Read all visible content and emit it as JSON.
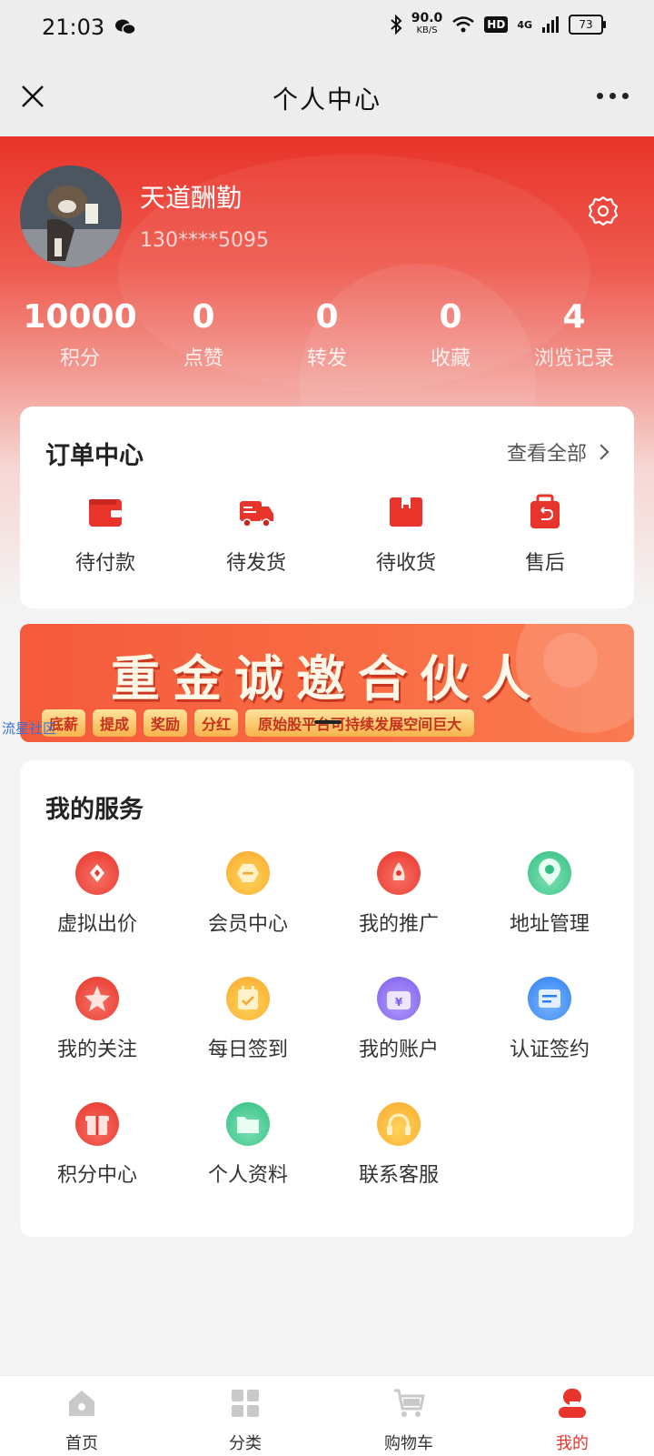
{
  "status_bar": {
    "time": "21:03",
    "speed_value": "90.0",
    "speed_unit": "KB/S",
    "hd": "HD",
    "network": "4G",
    "battery": "73"
  },
  "title_bar": {
    "title": "个人中心"
  },
  "profile": {
    "name": "天道酬勤",
    "phone": "130****5095"
  },
  "stats": [
    {
      "value": "10000",
      "label": "积分"
    },
    {
      "value": "0",
      "label": "点赞"
    },
    {
      "value": "0",
      "label": "转发"
    },
    {
      "value": "0",
      "label": "收藏"
    },
    {
      "value": "4",
      "label": "浏览记录"
    }
  ],
  "orders": {
    "title": "订单中心",
    "view_all": "查看全部",
    "items": [
      {
        "label": "待付款",
        "icon": "wallet-icon"
      },
      {
        "label": "待发货",
        "icon": "truck-icon"
      },
      {
        "label": "待收货",
        "icon": "box-icon"
      },
      {
        "label": "售后",
        "icon": "refund-bag-icon"
      }
    ]
  },
  "banner": {
    "title": "重金诚邀合伙人",
    "tags": [
      "底薪",
      "提成",
      "奖励",
      "分红",
      "原始股平台可持续发展空间巨大"
    ]
  },
  "watermark": "流星社区",
  "services": {
    "title": "我的服务",
    "items": [
      {
        "label": "虚拟出价",
        "icon": "bid-icon",
        "color": "#f0483c"
      },
      {
        "label": "会员中心",
        "icon": "member-icon",
        "color": "#f8b52c"
      },
      {
        "label": "我的推广",
        "icon": "promote-icon",
        "color": "#f0483c"
      },
      {
        "label": "地址管理",
        "icon": "location-icon",
        "color": "#3cc48a"
      },
      {
        "label": "我的关注",
        "icon": "star-icon",
        "color": "#f0483c"
      },
      {
        "label": "每日签到",
        "icon": "calendar-icon",
        "color": "#f8b52c"
      },
      {
        "label": "我的账户",
        "icon": "wallet-yen-icon",
        "color": "#8a6cf0"
      },
      {
        "label": "认证签约",
        "icon": "certificate-icon",
        "color": "#3a8cf0"
      },
      {
        "label": "积分中心",
        "icon": "gift-icon",
        "color": "#f0483c"
      },
      {
        "label": "个人资料",
        "icon": "folder-icon",
        "color": "#3cc48a"
      },
      {
        "label": "联系客服",
        "icon": "headset-icon",
        "color": "#f8b52c"
      }
    ]
  },
  "bottom_nav": [
    {
      "label": "首页",
      "icon": "home-icon"
    },
    {
      "label": "分类",
      "icon": "category-icon"
    },
    {
      "label": "购物车",
      "icon": "cart-icon"
    },
    {
      "label": "我的",
      "icon": "profile-icon",
      "active": true
    }
  ],
  "colors": {
    "primary": "#e8342a",
    "background": "#f4f4f4"
  }
}
